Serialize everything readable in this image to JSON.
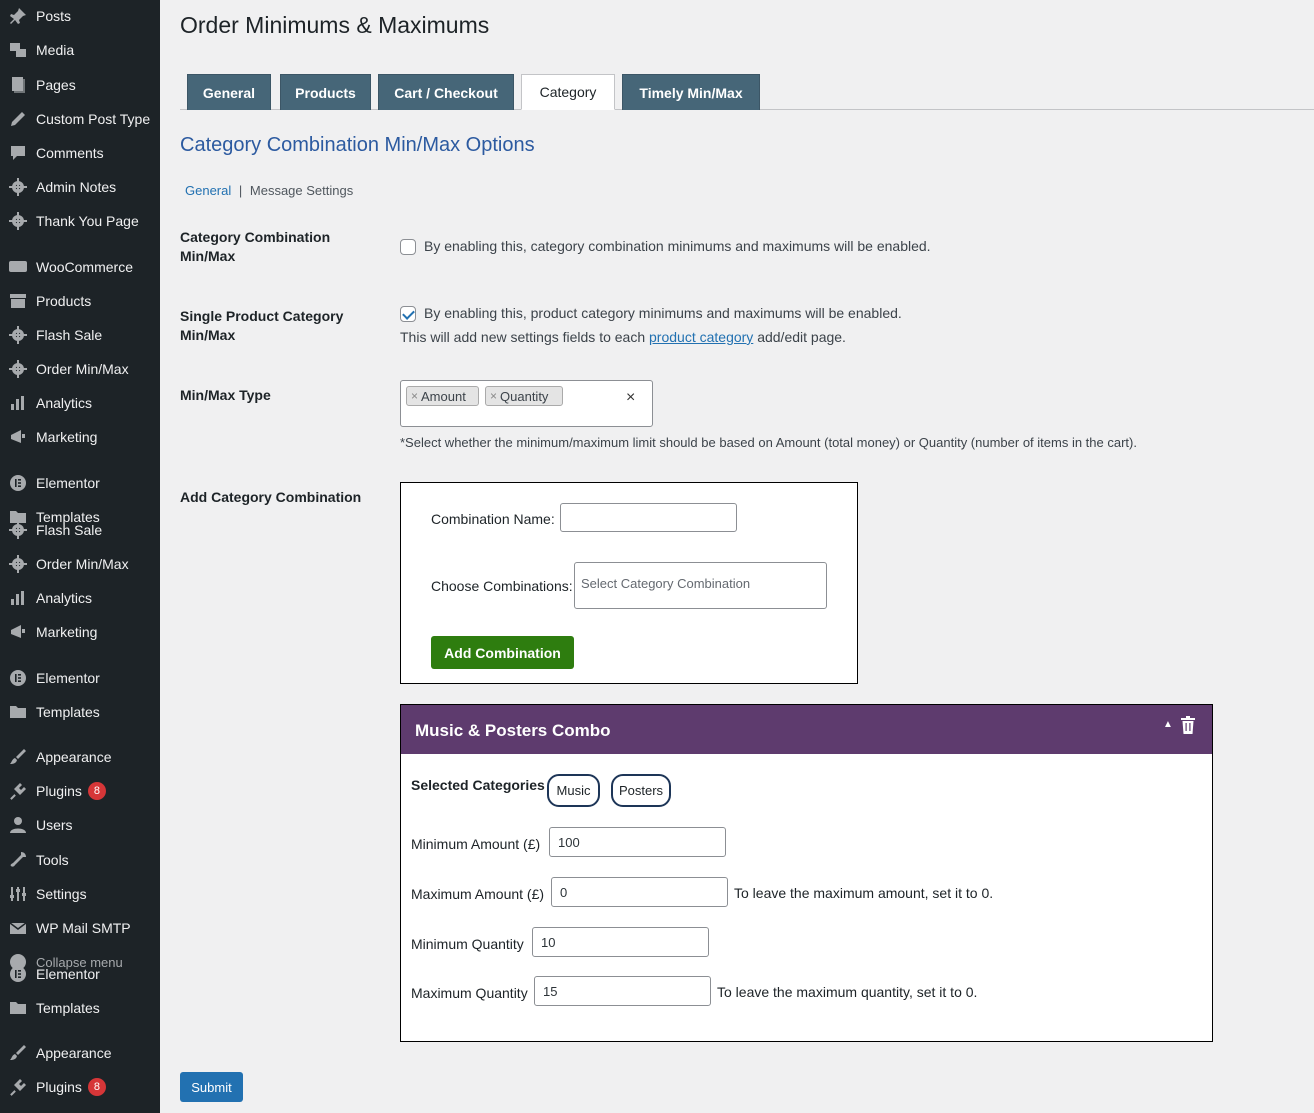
{
  "sidebar": {
    "items": [
      {
        "label": "Posts",
        "icon": "pin-icon"
      },
      {
        "label": "Media",
        "icon": "media-icon"
      },
      {
        "label": "Pages",
        "icon": "pages-icon"
      },
      {
        "label": "Custom Post Type",
        "icon": "pencil-icon"
      },
      {
        "label": "Comments",
        "icon": "comment-icon"
      },
      {
        "label": "Admin Notes",
        "icon": "gear-icon"
      },
      {
        "label": "Thank You Page",
        "icon": "gear-icon"
      },
      {
        "label": "WooCommerce",
        "icon": "woo-icon"
      },
      {
        "label": "Products",
        "icon": "archive-icon"
      },
      {
        "label": "Flash Sale",
        "icon": "gear-icon"
      },
      {
        "label": "Order Min/Max",
        "icon": "gear-icon"
      },
      {
        "label": "Analytics",
        "icon": "bar-chart-icon"
      },
      {
        "label": "Marketing",
        "icon": "megaphone-icon"
      },
      {
        "label": "Elementor",
        "icon": "elementor-icon"
      },
      {
        "label": "Templates",
        "icon": "folder-icon"
      },
      {
        "label": "Flash Sale",
        "icon": "gear-icon"
      },
      {
        "label": "Order Min/Max",
        "icon": "gear-icon"
      },
      {
        "label": "Analytics",
        "icon": "bar-chart-icon"
      },
      {
        "label": "Marketing",
        "icon": "megaphone-icon"
      },
      {
        "label": "Elementor",
        "icon": "elementor-icon"
      },
      {
        "label": "Templates",
        "icon": "folder-icon"
      },
      {
        "label": "Appearance",
        "icon": "brush-icon"
      },
      {
        "label": "Plugins",
        "icon": "plug-icon",
        "badge": "8"
      },
      {
        "label": "Users",
        "icon": "user-icon"
      },
      {
        "label": "Tools",
        "icon": "wrench-icon"
      },
      {
        "label": "Settings",
        "icon": "settings-icon"
      },
      {
        "label": "WP Mail SMTP",
        "icon": "mail-icon"
      },
      {
        "label": "Collapse menu",
        "icon": "collapse-icon"
      },
      {
        "label": "Elementor",
        "icon": "elementor-icon"
      },
      {
        "label": "Templates",
        "icon": "folder-icon"
      },
      {
        "label": "Appearance",
        "icon": "brush-icon"
      },
      {
        "label": "Plugins",
        "icon": "plug-icon",
        "badge": "8"
      }
    ]
  },
  "page": {
    "title": "Order Minimums & Maximums",
    "tabs": [
      "General",
      "Products",
      "Cart / Checkout",
      "Category",
      "Timely Min/Max"
    ],
    "active_tab": "Category",
    "section_title": "Category Combination Min/Max Options",
    "subnav": {
      "general": "General",
      "separator": "|",
      "messages": "Message Settings"
    }
  },
  "settings": {
    "combo_label": "Category Combination Min/Max",
    "combo_desc": "By enabling this, category combination minimums and maximums will be enabled.",
    "combo_checked": false,
    "single_label": "Single Product Category Min/Max",
    "single_desc": "By enabling this, product category minimums and maximums will be enabled.",
    "single_checked": true,
    "single_note_pre": "This will add new settings fields to each ",
    "single_note_link": "product category",
    "single_note_post": " add/edit page.",
    "type_label": "Min/Max Type",
    "type_chips": [
      "Amount",
      "Quantity"
    ],
    "type_chip_x": "×",
    "type_clear": "×",
    "type_help": "*Select whether the minimum/maximum limit should be based on Amount (total money) or Quantity (number of items in the cart).",
    "add_label": "Add Category Combination"
  },
  "add_box": {
    "name_label": "Combination Name:",
    "name_value": "",
    "choose_label": "Choose Combinations:",
    "choose_placeholder": "Select Category Combination",
    "button": "Add Combination"
  },
  "combo": {
    "title": "Music & Posters Combo",
    "arrow": "▲",
    "selected_label": "Selected Categories",
    "categories": [
      "Music",
      "Posters"
    ],
    "min_amount_label": "Minimum Amount (£)",
    "min_amount": "100",
    "max_amount_label": "Maximum Amount (£)",
    "max_amount": "0",
    "max_amount_note": "To leave the maximum amount, set it to 0.",
    "min_qty_label": "Minimum Quantity",
    "min_qty": "10",
    "max_qty_label": "Maximum Quantity",
    "max_qty": "15",
    "max_qty_note": "To leave the maximum quantity, set it to 0."
  },
  "submit_label": "Submit",
  "colors": {
    "sidebar_bg": "#1d2327",
    "tab_bg": "#466678",
    "section_title": "#2c5aa0",
    "combo_header": "#5e3b6e",
    "green_button": "#2e7d0f",
    "submit_button": "#2271b1",
    "badge": "#d63638"
  }
}
